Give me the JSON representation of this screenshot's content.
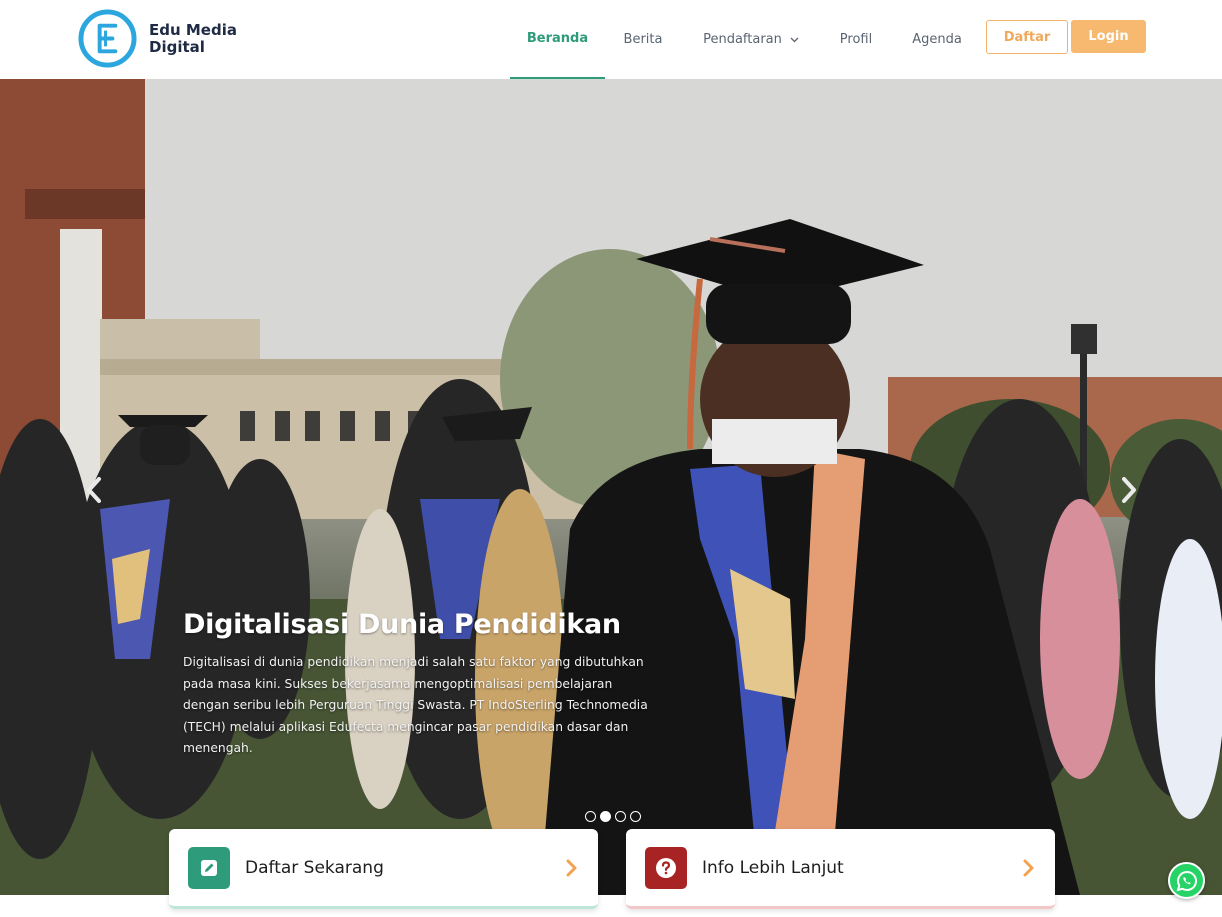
{
  "brand": {
    "name_line1": "Edu Media",
    "name_line2": "Digital",
    "logo_icon": "edu-media-logo"
  },
  "nav": {
    "items": [
      {
        "label": "Beranda",
        "active": true
      },
      {
        "label": "Berita",
        "active": false
      },
      {
        "label": "Pendaftaran",
        "active": false,
        "has_dropdown": true
      },
      {
        "label": "Profil",
        "active": false
      },
      {
        "label": "Agenda",
        "active": false
      }
    ],
    "dropdown_icon": "chevron-down-icon",
    "daftar_label": "Daftar",
    "login_label": "Login"
  },
  "hero": {
    "title": "Digitalisasi Dunia Pendidikan",
    "description": "Digitalisasi di dunia pendidikan menjadi salah satu faktor yang dibutuhkan pada masa kini. Sukses bekerjasama mengoptimalisasi pembelajaran dengan seribu lebih Perguruan Tinggi Swasta. PT IndoSterling Technomedia (TECH) melalui aplikasi Edufecta mengincar pasar pendidikan dasar dan menengah.",
    "prev_icon": "chevron-left-icon",
    "next_icon": "chevron-right-icon",
    "slides_total": 4,
    "active_slide": 2
  },
  "cards": [
    {
      "label": "Daftar Sekarang",
      "icon": "edit-icon",
      "color": "#2e9c7a"
    },
    {
      "label": "Info Lebih Lanjut",
      "icon": "question-icon",
      "color": "#a82424"
    }
  ],
  "colors": {
    "primary": "#2e9c7a",
    "accent": "#f6b96f",
    "logo_blue": "#2ba6de"
  },
  "whatsapp_icon": "whatsapp-icon"
}
